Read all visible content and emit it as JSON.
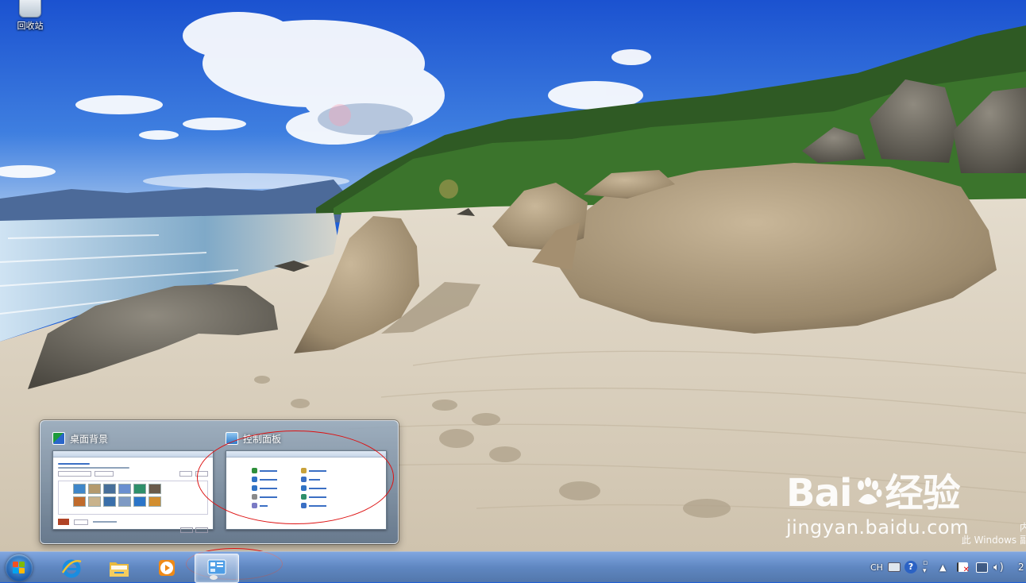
{
  "desktop": {
    "icons": [
      {
        "label": "回收站",
        "icon": "recycle-bin-icon"
      }
    ]
  },
  "watermark": {
    "logo_left": "Bai",
    "logo_right": "经验",
    "url": "jingyan.baidu.com"
  },
  "activation_notice": {
    "line1": "内",
    "line2": "此 Windows 副"
  },
  "thumbnail_popup": {
    "items": [
      {
        "title": "桌面背景",
        "icon": "desktop-background-icon"
      },
      {
        "title": "控制面板",
        "icon": "control-panel-icon"
      }
    ]
  },
  "taskbar": {
    "start_icon": "windows-start-icon",
    "pinned": [
      {
        "name": "internet-explorer",
        "icon": "ie-icon"
      },
      {
        "name": "windows-explorer",
        "icon": "folder-icon"
      },
      {
        "name": "media-player",
        "icon": "media-player-icon"
      },
      {
        "name": "control-panel",
        "icon": "control-panel-icon",
        "active": true
      }
    ],
    "tray": {
      "language": "CH",
      "keyboard_icon": "keyboard-icon",
      "help_icon": "help-icon",
      "show_hidden_icon": "chevron-up-icon",
      "action_center_icon": "flag-icon",
      "network_icon": "network-icon",
      "volume_icon": "volume-icon",
      "clock_fragment": "2"
    }
  },
  "colors": {
    "annotation_ellipse": "#dd1111",
    "taskbar_tint": "#6f8fb5",
    "sky": "#1f5fd6"
  }
}
